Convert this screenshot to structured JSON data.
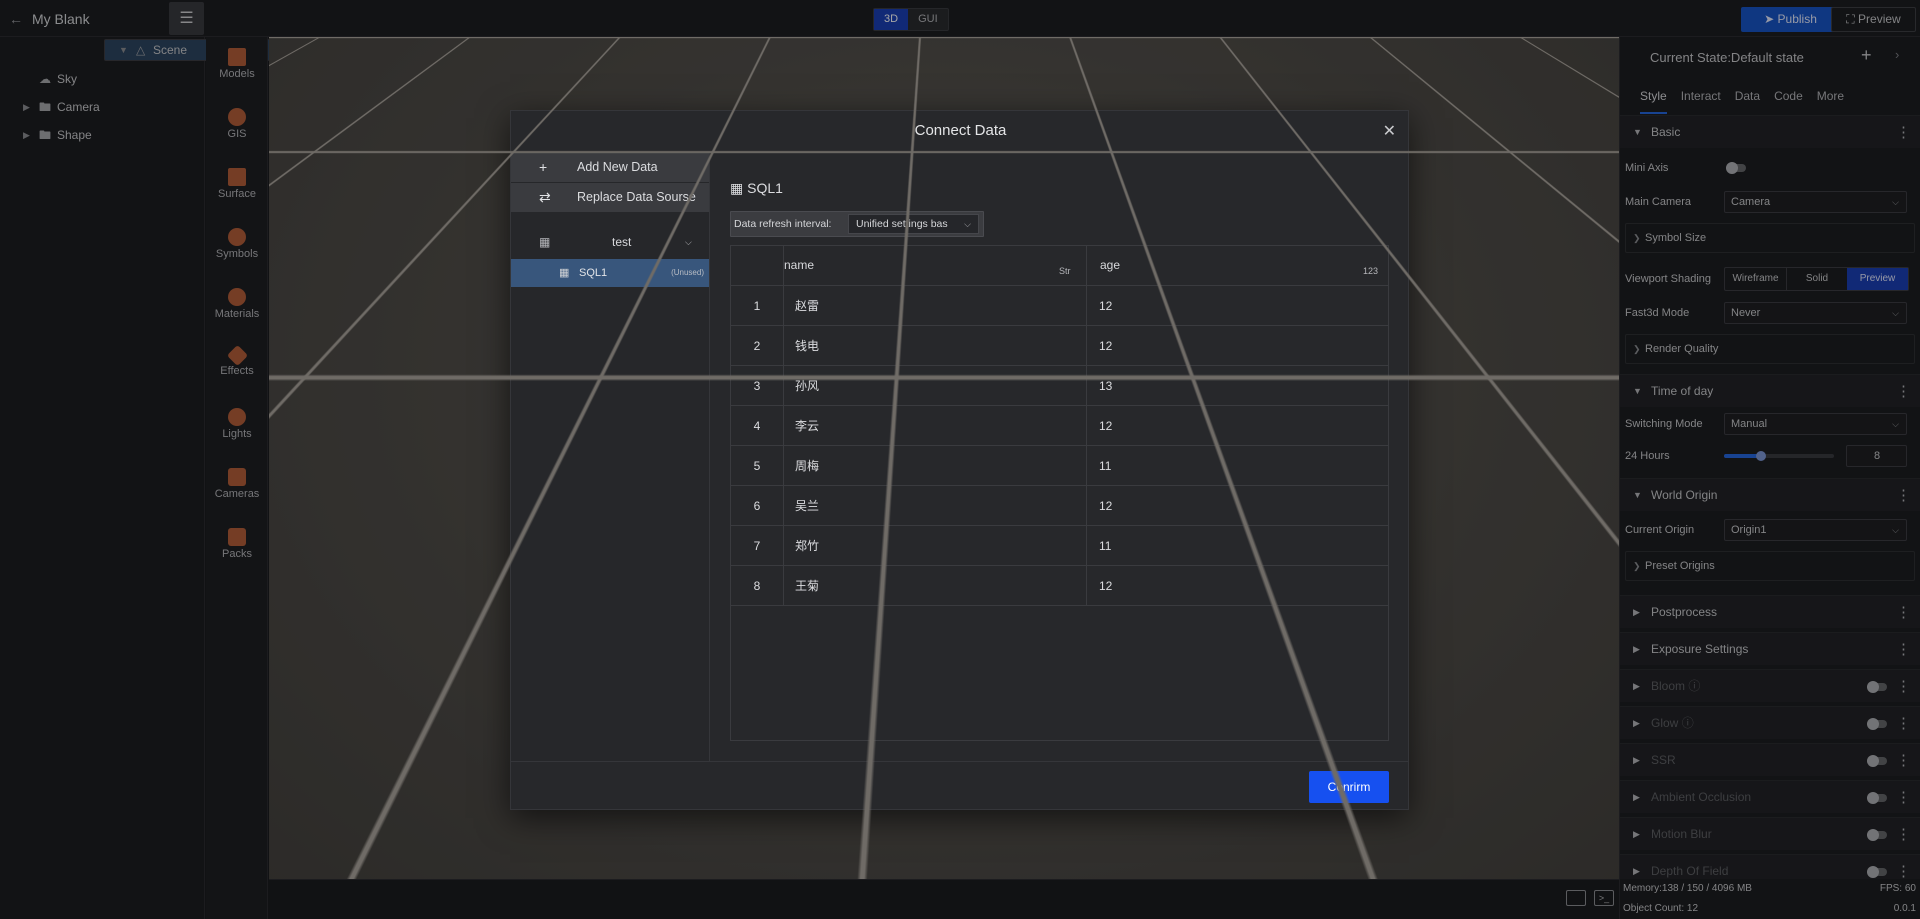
{
  "app": {
    "title": "My Blank"
  },
  "toolbar": {
    "mode_3d": "3D",
    "mode_gui": "GUI",
    "publish": "Publish",
    "preview": "Preview"
  },
  "outline": {
    "items": [
      {
        "label": "Scene"
      },
      {
        "label": "Sky"
      },
      {
        "label": "Camera"
      },
      {
        "label": "Shape"
      }
    ]
  },
  "assets": {
    "items": [
      {
        "label": "Models"
      },
      {
        "label": "GIS"
      },
      {
        "label": "Surface"
      },
      {
        "label": "Symbols"
      },
      {
        "label": "Materials"
      },
      {
        "label": "Effects"
      },
      {
        "label": "Lights"
      },
      {
        "label": "Cameras"
      },
      {
        "label": "Packs"
      }
    ]
  },
  "props": {
    "state": "Current State:Default state",
    "tabs": [
      "Style",
      "Interact",
      "Data",
      "Code",
      "More"
    ],
    "basic": "Basic",
    "mini_axis": "Mini Axis",
    "main_camera": {
      "label": "Main Camera",
      "value": "Camera"
    },
    "symbol_size": "Symbol Size",
    "viewport_shading": {
      "label": "Viewport Shading",
      "options": [
        "Wireframe",
        "Solid",
        "Preview"
      ]
    },
    "fast3d": {
      "label": "Fast3d Mode",
      "value": "Never"
    },
    "render_quality": "Render Quality",
    "time_of_day": "Time of day",
    "switching_mode": {
      "label": "Switching Mode",
      "value": "Manual"
    },
    "hours": {
      "label": "24 Hours",
      "value": "8"
    },
    "world_origin": "World Origin",
    "current_origin": {
      "label": "Current Origin",
      "value": "Origin1"
    },
    "preset_origins": "Preset Origins",
    "postprocess": "Postprocess",
    "exposure": "Exposure Settings",
    "bloom": "Bloom",
    "glow": "Glow",
    "ssr": "SSR",
    "ao": "Ambient Occlusion",
    "motion_blur": "Motion Blur",
    "dof": "Depth Of Field"
  },
  "status": {
    "memory": "Memory:138 / 150 / 4096 MB",
    "fps": "FPS: 60",
    "objects": "Object Count: 12",
    "version": "0.0.1"
  },
  "modal": {
    "title": "Connect Data",
    "add_new": "Add New Data",
    "replace": "Replace Data Sourse",
    "group": "test",
    "source": {
      "name": "SQL1",
      "tag": "(Unused)"
    },
    "source_title": "SQL1",
    "refresh_label": "Data refresh interval:",
    "refresh_value": "Unified settings bas",
    "columns": [
      {
        "name": "name",
        "type": "Str"
      },
      {
        "name": "age",
        "type": "123"
      }
    ],
    "rows": [
      {
        "idx": "1",
        "name": "赵雷",
        "age": "12"
      },
      {
        "idx": "2",
        "name": "钱电",
        "age": "12"
      },
      {
        "idx": "3",
        "name": "孙风",
        "age": "13"
      },
      {
        "idx": "4",
        "name": "李云",
        "age": "12"
      },
      {
        "idx": "5",
        "name": "周梅",
        "age": "11"
      },
      {
        "idx": "6",
        "name": "吴兰",
        "age": "12"
      },
      {
        "idx": "7",
        "name": "郑竹",
        "age": "11"
      },
      {
        "idx": "8",
        "name": "王菊",
        "age": "12"
      }
    ],
    "confirm": "Conrirm"
  }
}
